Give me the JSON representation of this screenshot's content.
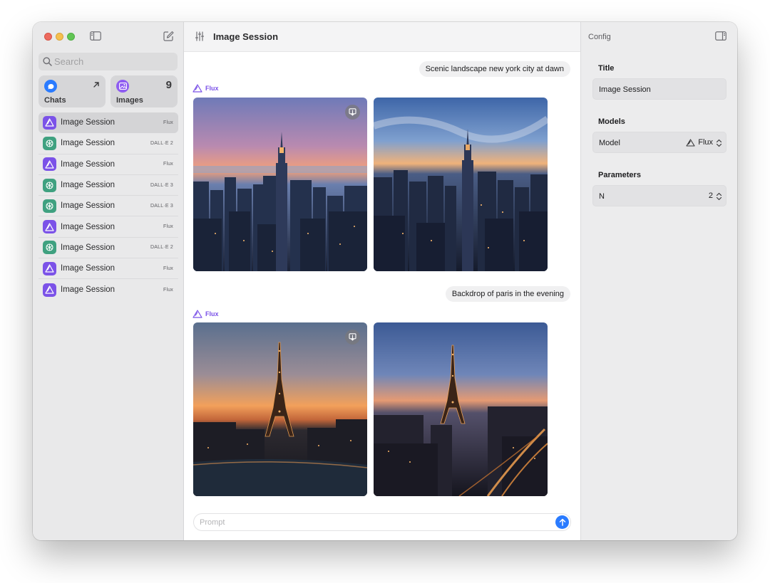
{
  "sidebar": {
    "search_placeholder": "Search",
    "cards": {
      "chats_label": "Chats",
      "images_label": "Images",
      "images_count": "9"
    },
    "items": [
      {
        "title": "Image Session",
        "model": "Flux",
        "icon": "flux-icon"
      },
      {
        "title": "Image Session",
        "model": "DALL·E 2",
        "icon": "openai-icon"
      },
      {
        "title": "Image Session",
        "model": "Flux",
        "icon": "flux-icon"
      },
      {
        "title": "Image Session",
        "model": "DALL·E 3",
        "icon": "openai-icon"
      },
      {
        "title": "Image Session",
        "model": "DALL·E 3",
        "icon": "openai-icon"
      },
      {
        "title": "Image Session",
        "model": "Flux",
        "icon": "flux-icon"
      },
      {
        "title": "Image Session",
        "model": "DALL·E 2",
        "icon": "openai-icon"
      },
      {
        "title": "Image Session",
        "model": "Flux",
        "icon": "flux-icon"
      },
      {
        "title": "Image Session",
        "model": "Flux",
        "icon": "flux-icon"
      }
    ]
  },
  "main": {
    "title": "Image Session",
    "messages": [
      {
        "prompt": "Scenic landscape new york city at dawn",
        "model": "Flux"
      },
      {
        "prompt": "Backdrop of paris in the evening",
        "model": "Flux"
      }
    ],
    "prompt_placeholder": "Prompt"
  },
  "config": {
    "header": "Config",
    "title_section": "Title",
    "title_value": "Image Session",
    "models_section": "Models",
    "model_label": "Model",
    "model_value": "Flux",
    "parameters_section": "Parameters",
    "n_label": "N",
    "n_value": "2"
  },
  "colors": {
    "accent_blue": "#2a7bff",
    "flux_purple": "#7b52e8",
    "openai_green": "#3fa180"
  }
}
